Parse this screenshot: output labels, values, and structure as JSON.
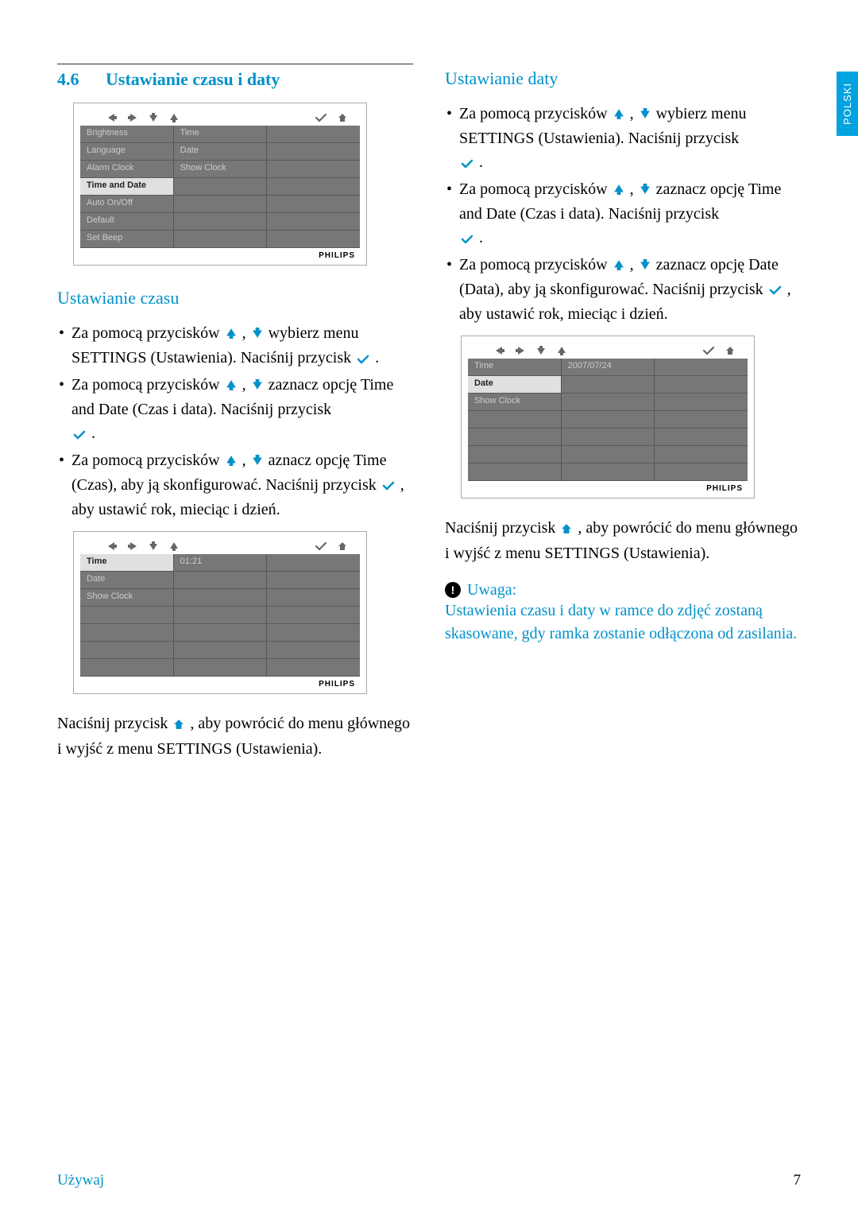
{
  "lang_tab": "POLSKI",
  "section": {
    "num": "4.6",
    "title": "Ustawianie czasu i daty"
  },
  "shot1": {
    "brand": "PHILIPS",
    "col1": [
      "Brightness",
      "Language",
      "Alarm Clock",
      "Time and Date",
      "Auto On/Off",
      "Default",
      "Set Beep"
    ],
    "selected1": 3,
    "col2": [
      "Time",
      "Date",
      "Show Clock",
      "",
      "",
      "",
      ""
    ]
  },
  "sub_time": "Ustawianie czasu",
  "time_bullets": {
    "b1a": "Za pomocą przycisków ",
    "b1b": " , ",
    "b1c": "  wybierz menu SETTINGS (Ustawienia). Naciśnij przycisk ",
    "b1d": " .",
    "b2a": "Za pomocą przycisków ",
    "b2b": " , ",
    "b2c": "  zaznacz opcję Time and Date (Czas i data). Naciśnij przycisk ",
    "b2d": " .",
    "b3a": "Za pomocą przycisków ",
    "b3b": " , ",
    "b3c": "  aznacz opcję Time (Czas), aby ją skonfigurować. Naciśnij przycisk ",
    "b3d": " , aby  ustawić rok, mieciąc i dzień."
  },
  "shot2": {
    "brand": "PHILIPS",
    "col1": [
      "Time",
      "Date",
      "Show Clock",
      "",
      "",
      "",
      ""
    ],
    "selected1": 0,
    "col2": [
      "01:21",
      "",
      "",
      "",
      "",
      "",
      ""
    ]
  },
  "return_text_a": "Naciśnij przycisk ",
  "return_text_b": " , aby powrócić do menu głównego i wyjść z menu SETTINGS (Ustawienia).",
  "sub_date": "Ustawianie daty",
  "date_bullets": {
    "b1a": "Za pomocą przycisków ",
    "b1b": " , ",
    "b1c": "  wybierz menu SETTINGS (Ustawienia). Naciśnij przycisk ",
    "b1d": " .",
    "b2a": "Za pomocą przycisków ",
    "b2b": " , ",
    "b2c": "  zaznacz opcję Time and Date (Czas i data). Naciśnij przycisk ",
    "b2d": " .",
    "b3a": "Za pomocą przycisków ",
    "b3b": " , ",
    "b3c": "  zaznacz opcję Date (Data), aby ją skonfigurować. Naciśnij przycisk ",
    "b3d": " , aby ustawić rok, mieciąc i dzień."
  },
  "shot3": {
    "brand": "PHILIPS",
    "col1": [
      "Time",
      "Date",
      "Show Clock",
      "",
      "",
      "",
      ""
    ],
    "selected1": 1,
    "col2": [
      "2007/07/24",
      "",
      "",
      "",
      "",
      "",
      ""
    ]
  },
  "note": {
    "title": "Uwaga:",
    "body": "Ustawienia czasu i daty w ramce do zdjęć zostaną skasowane, gdy ramka zostanie odłączona od zasilania."
  },
  "footer": {
    "left": "Używaj",
    "right": "7"
  }
}
